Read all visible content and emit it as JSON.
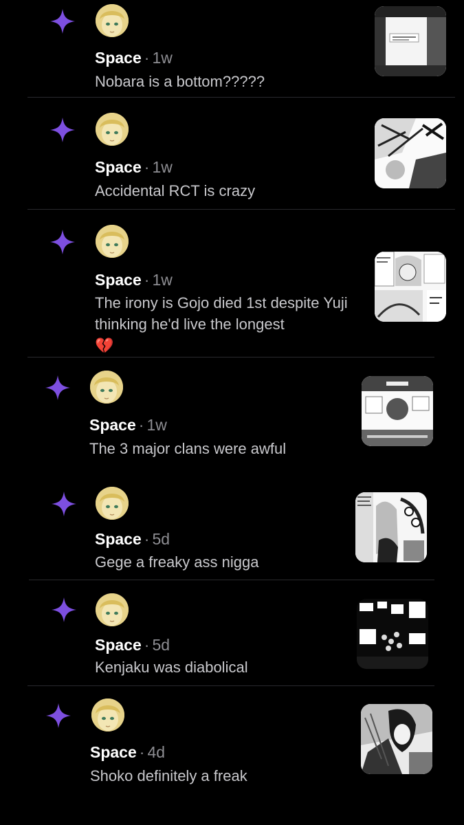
{
  "colors": {
    "star": "#7d4fe0",
    "background": "#000000",
    "muted": "#8e8e93",
    "text": "#c9c9cd"
  },
  "posts": [
    {
      "name": "Space",
      "separator": "·",
      "time": "1w",
      "text": "Nobara is a bottom?????",
      "emoji": "",
      "thumbnail_icon": "manga-panel-thumbnail"
    },
    {
      "name": "Space",
      "separator": "·",
      "time": "1w",
      "text": "Accidental RCT is crazy",
      "emoji": "",
      "thumbnail_icon": "manga-panel-thumbnail"
    },
    {
      "name": "Space",
      "separator": "·",
      "time": "1w",
      "text": "The irony is Gojo died 1st despite Yuji thinking he'd live the longest",
      "emoji": "💔",
      "thumbnail_icon": "manga-panel-thumbnail"
    },
    {
      "name": "Space",
      "separator": "·",
      "time": "1w",
      "text": "The 3 major clans were awful",
      "emoji": "",
      "thumbnail_icon": "manga-panel-thumbnail"
    },
    {
      "name": "Space",
      "separator": "·",
      "time": "5d",
      "text": "Gege a freaky ass nigga",
      "emoji": "",
      "thumbnail_icon": "manga-panel-thumbnail"
    },
    {
      "name": "Space",
      "separator": "·",
      "time": "5d",
      "text": "Kenjaku was diabolical",
      "emoji": "",
      "thumbnail_icon": "manga-panel-thumbnail"
    },
    {
      "name": "Space",
      "separator": "·",
      "time": "4d",
      "text": "Shoko definitely a freak",
      "emoji": "",
      "thumbnail_icon": "manga-panel-thumbnail"
    }
  ]
}
